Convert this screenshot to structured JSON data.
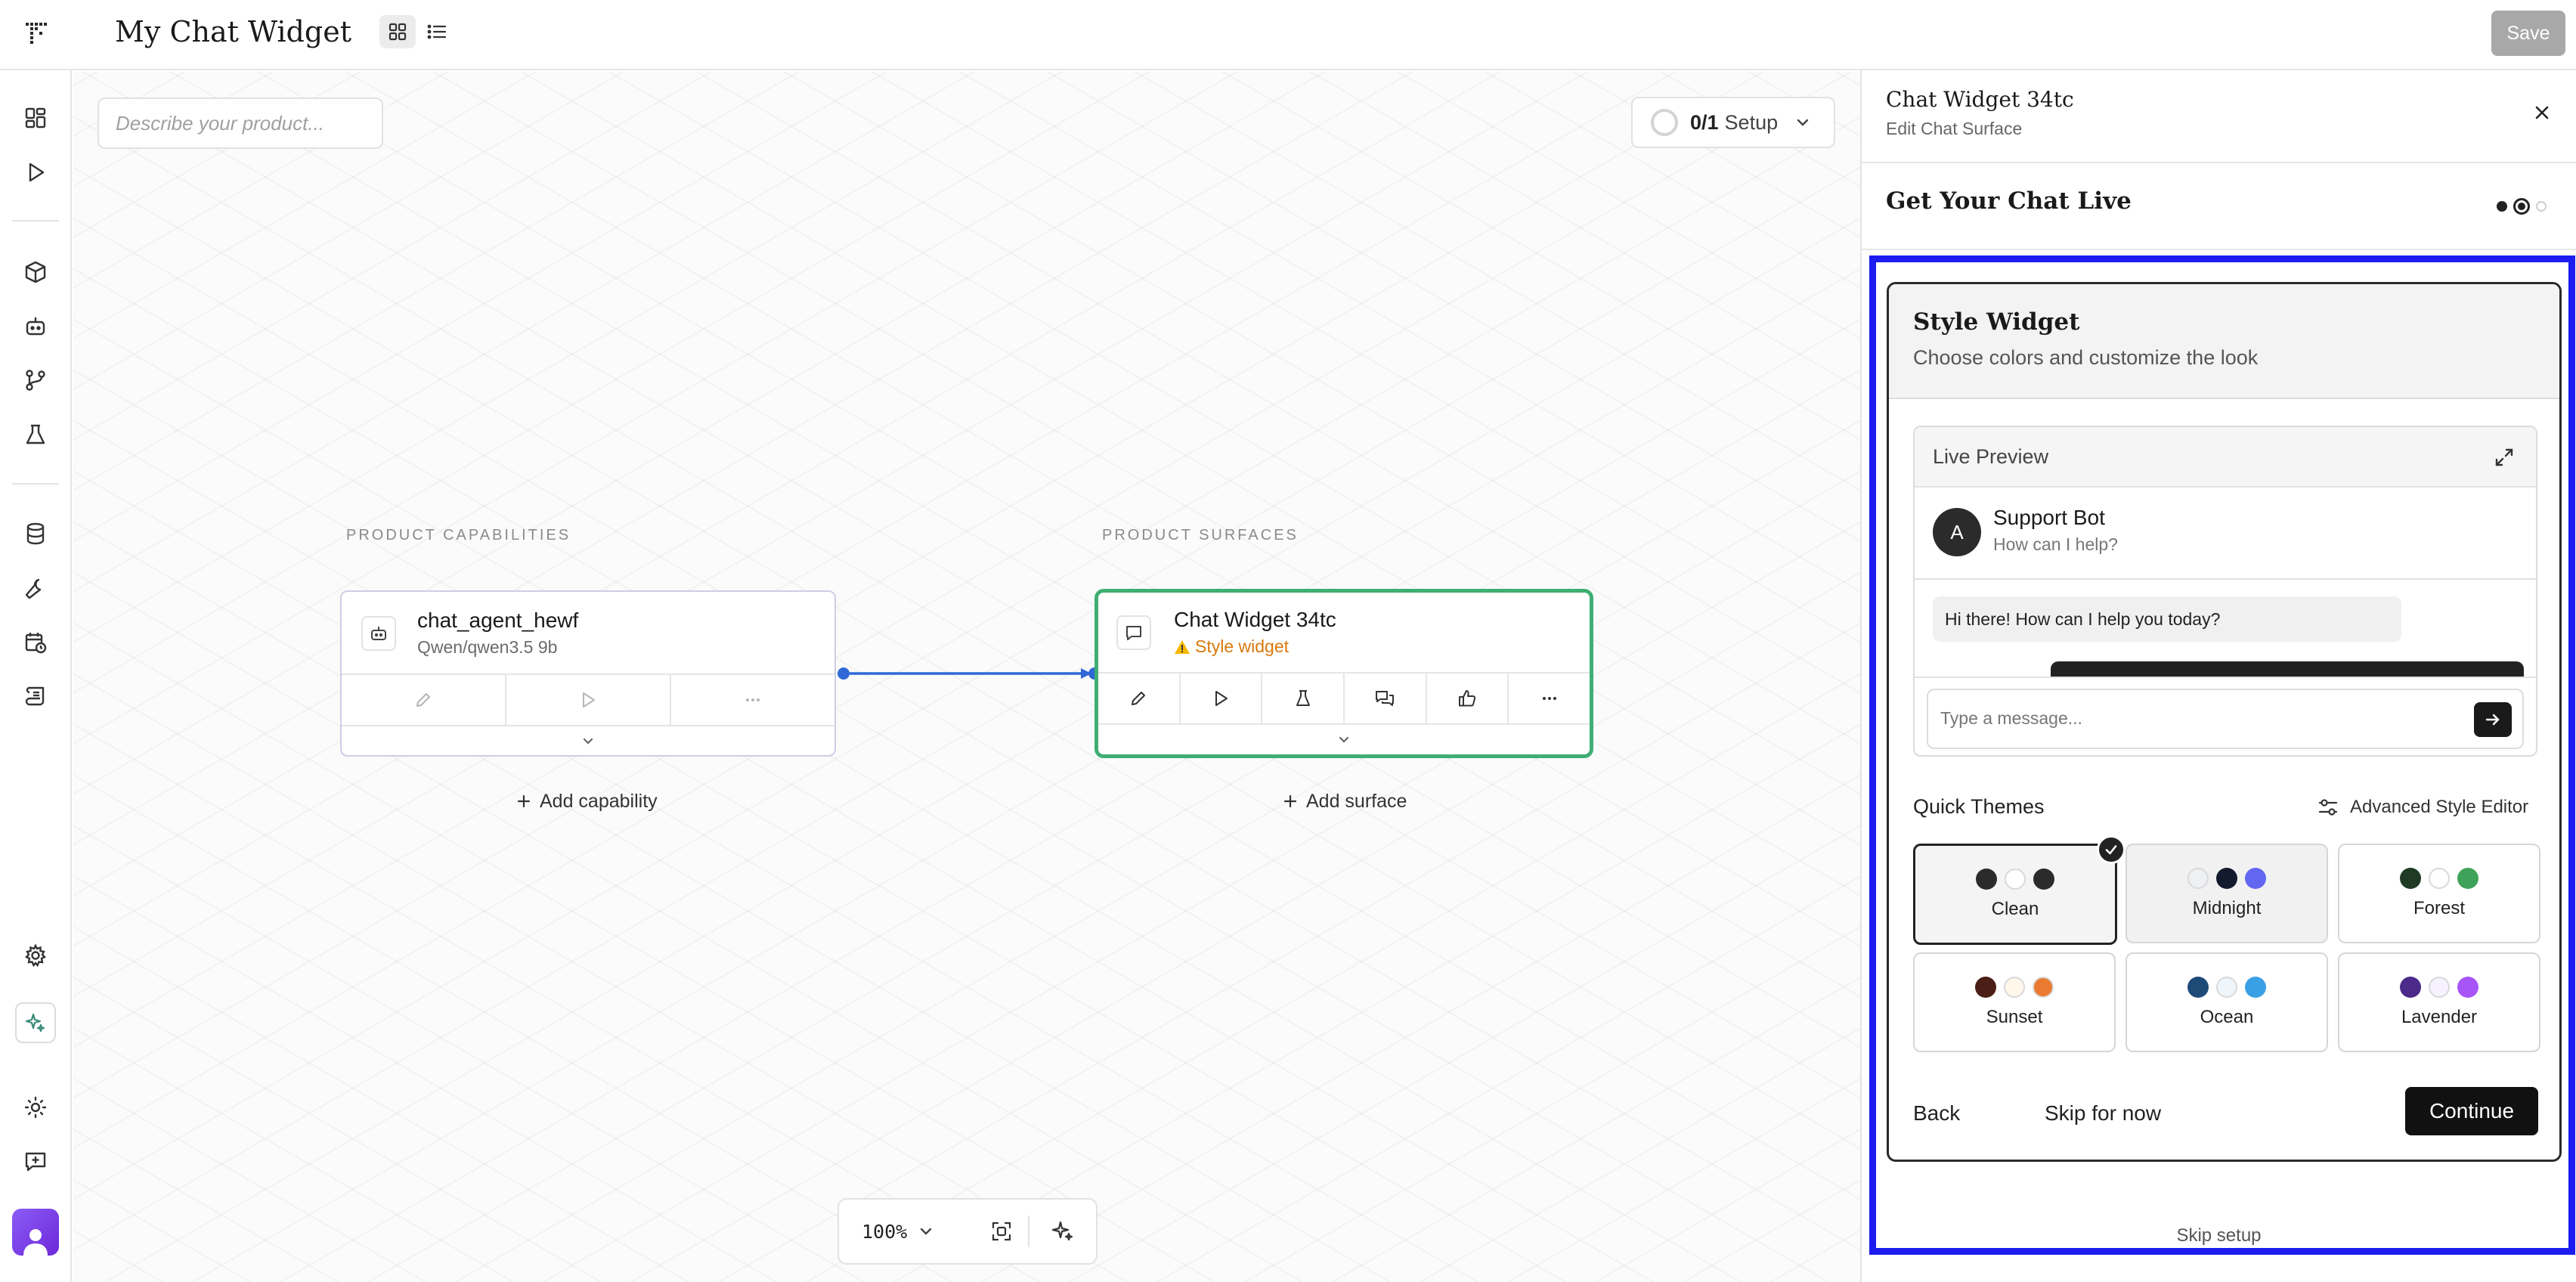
{
  "header": {
    "title": "My Chat Widget",
    "save_label": "Save"
  },
  "canvas": {
    "product_input_placeholder": "Describe your product...",
    "setup_progress": "0/1",
    "setup_label": "Setup",
    "capabilities_heading": "PRODUCT CAPABILITIES",
    "surfaces_heading": "PRODUCT SURFACES",
    "capability_node": {
      "name": "chat_agent_hewf",
      "model": "Qwen/qwen3.5 9b"
    },
    "surface_node": {
      "name": "Chat Widget 34tc",
      "warning": "Style widget"
    },
    "add_capability_label": "Add capability",
    "add_surface_label": "Add surface",
    "zoom_level": "100%"
  },
  "panel": {
    "title": "Chat Widget 34tc",
    "subtitle": "Edit Chat Surface",
    "step_title": "Get Your Chat Live",
    "step_total": 3,
    "step_current": 2,
    "style_title": "Style Widget",
    "style_subtitle": "Choose colors and customize the look",
    "preview": {
      "label": "Live Preview",
      "bot_avatar_letter": "A",
      "bot_name": "Support Bot",
      "bot_tagline": "How can I help?",
      "greeting": "Hi there! How can I help you today?",
      "input_placeholder": "Type a message..."
    },
    "quick_themes_label": "Quick Themes",
    "advanced_editor_label": "Advanced Style Editor",
    "themes": [
      {
        "name": "Clean",
        "selected": true,
        "colors": [
          "#2b2b2b",
          "#ffffff",
          "#2b2b2b"
        ]
      },
      {
        "name": "Midnight",
        "selected": false,
        "colors": [
          "#eef0f4",
          "#141a2e",
          "#6366f1"
        ]
      },
      {
        "name": "Forest",
        "selected": false,
        "colors": [
          "#1f3b25",
          "#ffffff",
          "#3fa25a"
        ]
      },
      {
        "name": "Sunset",
        "selected": false,
        "colors": [
          "#4a1f16",
          "#fff8ea",
          "#ea7a30"
        ]
      },
      {
        "name": "Ocean",
        "selected": false,
        "colors": [
          "#1e4a78",
          "#eef6fc",
          "#3aa0e6"
        ]
      },
      {
        "name": "Lavender",
        "selected": false,
        "colors": [
          "#4b2a8a",
          "#f6f2ff",
          "#a855f7"
        ]
      }
    ],
    "back_label": "Back",
    "skip_label": "Skip for now",
    "continue_label": "Continue",
    "skip_setup_label": "Skip setup"
  },
  "colors": {
    "accent_green": "#3fae73",
    "edge_blue": "#2f68d6",
    "warning": "#d9780b",
    "highlight": "#1c1cf0"
  }
}
